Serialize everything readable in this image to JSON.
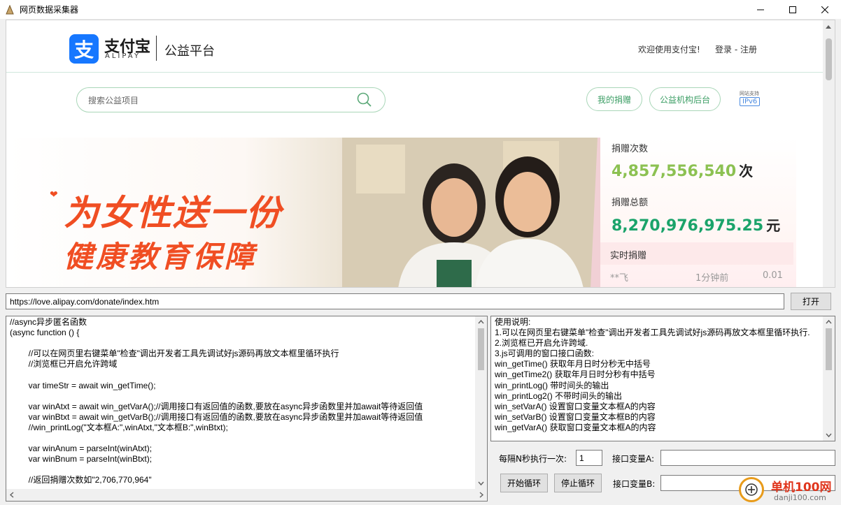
{
  "window": {
    "title": "网页数据采集器"
  },
  "browser": {
    "header": {
      "logo_mark": "支",
      "logo_cn": "支付宝",
      "logo_en": "ALIPAY",
      "logo_sub": "公益平台",
      "welcome": "欢迎使用支付宝!",
      "login": "登录 - 注册"
    },
    "search": {
      "placeholder": "搜索公益项目"
    },
    "buttons": {
      "my_donation": "我的捐赠",
      "org_backend": "公益机构后台"
    },
    "ipv6": {
      "caption": "网站支持",
      "label": "IPv6"
    },
    "banner": {
      "line1": "为女性送一份",
      "line2": "健康教育保障"
    },
    "stats": {
      "count_label": "捐赠次数",
      "count_value": "4,857,556,540",
      "count_unit": "次",
      "amount_label": "捐赠总额",
      "amount_value": "8,270,976,975.25",
      "amount_unit": "元",
      "realtime_title": "实时捐赠",
      "realtime_row": {
        "name": "**飞",
        "time": "1分钟前",
        "amount": "0.01"
      }
    },
    "colors": {
      "count": "#8cc152",
      "amount": "#1aa36a",
      "banner_text": "#f04e23"
    }
  },
  "url_bar": {
    "value": "https://love.alipay.com/donate/index.htm",
    "open_label": "打开"
  },
  "code_text": "//async异步匿名函数\n(async function () {\n\n\t\t//可以在网页里右键菜单\"检查\"调出开发者工具先调试好js源码再放文本框里循环执行\n\t\t//浏览框已开启允许跨域\n\n\t\tvar timeStr = await win_getTime();\n\n\t\tvar winAtxt = await win_getVarA();//调用接口有返回值的函数,要放在async异步函数里并加await等待返回值\n\t\tvar winBtxt = await win_getVarB();//调用接口有返回值的函数,要放在async异步函数里并加await等待返回值\n\t\t//win_printLog(\"文本框A:\",winAtxt,\"文本框B:\",winBtxt);\n\n\t\tvar winAnum = parseInt(winAtxt);\n\t\tvar winBnum = parseInt(winBtxt);\n\n\t\t//返回捐赠次数如\"2,706,770,964\"",
  "help_lines": [
    "使用说明:",
    "1.可以在网页里右键菜单\"检查\"调出开发者工具先调试好js源码再放文本框里循环执行.",
    "2.浏览框已开启允许跨域.",
    "3.js可调用的窗口接口函数:",
    "win_getTime() 获取年月日时分秒无中括号",
    "win_getTime2() 获取年月日时分秒有中括号",
    "win_printLog() 带时间头的输出",
    "win_printLog2() 不带时间头的输出",
    "win_setVarA() 设置窗口变量文本框A的内容",
    "win_setVarB() 设置窗口变量文本框B的内容",
    "win_getVarA() 获取窗口变量文本框A的内容"
  ],
  "controls": {
    "interval_label": "每隔N秒执行一次:",
    "interval_value": "1",
    "var_a_label": "接口变量A:",
    "var_a_value": "",
    "var_b_label": "接口变量B:",
    "var_b_value": "",
    "start_label": "开始循环",
    "stop_label": "停止循环"
  },
  "watermark": {
    "text": "单机100网",
    "url": "danji100.com"
  }
}
